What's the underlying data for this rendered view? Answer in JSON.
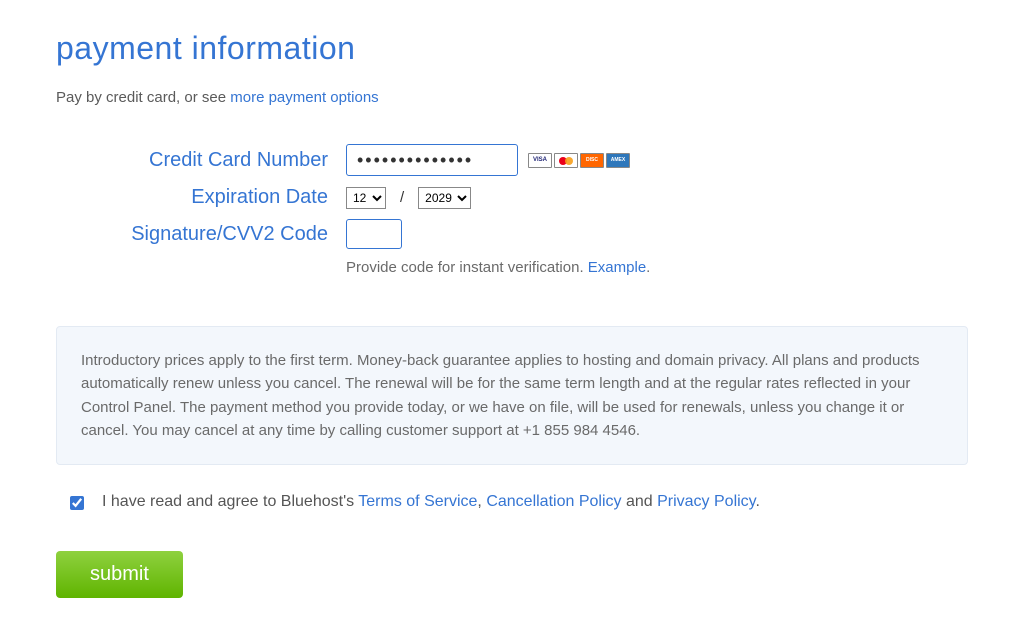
{
  "title": "payment information",
  "subline_prefix": "Pay by credit card, or see ",
  "subline_link": "more payment options",
  "labels": {
    "card_number": "Credit Card Number",
    "expiration": "Expiration Date",
    "cvv": "Signature/CVV2 Code"
  },
  "card_number_value": "••••••••••••••",
  "expiration": {
    "month": "12",
    "year": "2029",
    "separator": "/"
  },
  "cvv_value": "",
  "cvv_helper_prefix": "Provide code for instant verification. ",
  "cvv_helper_link": "Example",
  "cvv_helper_suffix": ".",
  "card_brands": [
    "VISA",
    "MC",
    "DISCOVER",
    "AMEX"
  ],
  "notice": "Introductory prices apply to the first term. Money-back guarantee applies to hosting and domain privacy. All plans and products automatically renew unless you cancel. The renewal will be for the same term length and at the regular rates reflected in your Control Panel. The payment method you provide today, or we have on file, will be used for renewals, unless you change it or cancel. You may cancel at any time by calling customer support at +1 855 984 4546.",
  "agree": {
    "checked": true,
    "prefix": "I have read and agree to Bluehost's ",
    "terms": "Terms of Service",
    "sep1": ", ",
    "cancel": "Cancellation Policy",
    "sep2": " and ",
    "privacy": "Privacy Policy",
    "suffix": "."
  },
  "submit_label": "submit"
}
